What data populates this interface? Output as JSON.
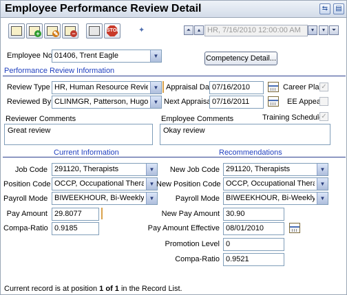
{
  "window": {
    "title": "Employee Performance Review Detail"
  },
  "navigator": {
    "record": "HR, 7/16/2010 12:00:00 AM"
  },
  "employee": {
    "label": "Employee No",
    "value": "01406, Trent Eagle"
  },
  "competency_button": "Competency Detail...",
  "section": {
    "performance": "Performance Review Information",
    "current": "Current Information",
    "recommendations": "Recommendations"
  },
  "review": {
    "type_label": "Review Type",
    "type_value": "HR, Human Resource Review",
    "by_label": "Reviewed By",
    "by_value": "CLINMGR, Patterson, Hugo",
    "appraisal_label": "Appraisal Date",
    "appraisal_value": "07/16/2010",
    "next_label": "Next Appraisal",
    "next_value": "07/16/2011",
    "career_label": "Career Plan",
    "career_checked": true,
    "ee_label": "EE Appeal",
    "ee_checked": false,
    "training_label": "Training Scheduled",
    "training_checked": true
  },
  "comments": {
    "reviewer_label": "Reviewer Comments",
    "reviewer_value": "Great review",
    "employee_label": "Employee Comments",
    "employee_value": "Okay review"
  },
  "current": {
    "job_label": "Job Code",
    "job_value": "291120, Therapists",
    "position_label": "Position Code",
    "position_value": "OCCP, Occupational Therapist",
    "payroll_label": "Payroll Mode",
    "payroll_value": "BIWEEKHOUR, Bi-Weekly Pay",
    "pay_label": "Pay Amount",
    "pay_value": "29.8077",
    "compa_label": "Compa-Ratio",
    "compa_value": "0.9185"
  },
  "recommended": {
    "job_label": "New Job Code",
    "job_value": "291120, Therapists",
    "position_label": "New Position Code",
    "position_value": "OCCP, Occupational Therapist",
    "payroll_label": "Payroll Mode",
    "payroll_value": "BIWEEKHOUR, Bi-Weekly Pay",
    "pay_label": "New Pay Amount",
    "pay_value": "30.90",
    "effective_label": "Pay Amount Effective",
    "effective_value": "08/01/2010",
    "promotion_label": "Promotion Level",
    "promotion_value": "0",
    "compa_label": "Compa-Ratio",
    "compa_value": "0.9521"
  },
  "footer": {
    "prefix": "Current record is at position ",
    "position": "1 of 1",
    "suffix": " in the Record List."
  }
}
